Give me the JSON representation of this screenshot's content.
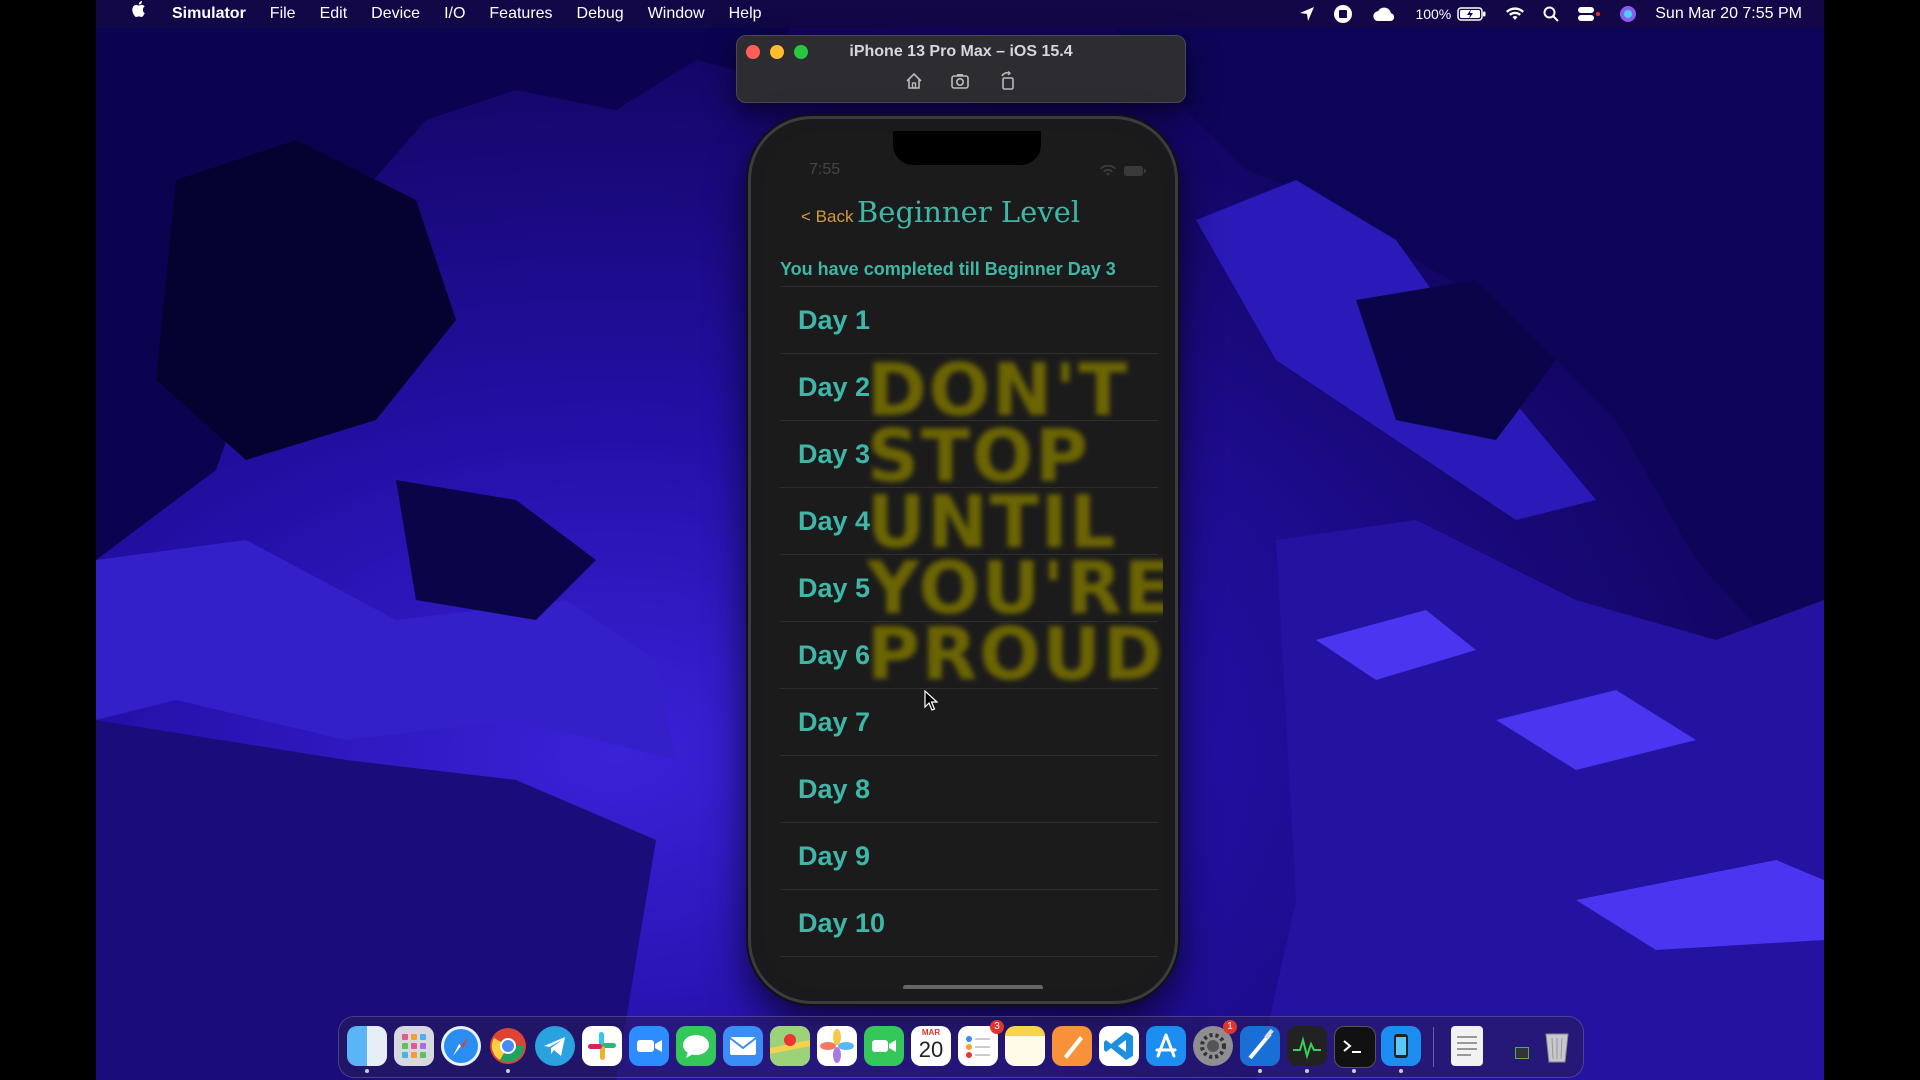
{
  "menubar": {
    "app": "Simulator",
    "items": [
      "File",
      "Edit",
      "Device",
      "I/O",
      "Features",
      "Debug",
      "Window",
      "Help"
    ],
    "battery": "100%",
    "datetime": "Sun Mar 20  7:55 PM"
  },
  "simulator": {
    "title": "iPhone 13 Pro Max – iOS 15.4"
  },
  "phone": {
    "clock": "7:55",
    "back_label": "< Back",
    "title": "Beginner Level",
    "status": "You have completed till Beginner Day 3",
    "days": [
      "Day 1",
      "Day 2",
      "Day 3",
      "Day 4",
      "Day 5",
      "Day 6",
      "Day 7",
      "Day 8",
      "Day 9",
      "Day 10"
    ],
    "background_words": [
      "DON'T",
      "STOP",
      "UNTIL",
      "YOU'RE",
      "PROUD"
    ]
  },
  "dock": {
    "calendar_month": "MAR",
    "calendar_day": "20",
    "reminders_badge": "3",
    "settings_badge": "1",
    "apps": [
      "finder-icon",
      "launchpad-icon",
      "safari-icon",
      "chrome-icon",
      "telegram-icon",
      "slack-icon",
      "zoom-icon",
      "messages-icon",
      "mail-icon",
      "maps-icon",
      "photos-icon",
      "facetime-icon",
      "calendar-icon",
      "reminders-icon",
      "notes-icon",
      "pages-icon",
      "vscode-icon",
      "appstore-icon",
      "settings-icon",
      "xcode-icon",
      "activity-monitor-icon",
      "terminal-icon",
      "simulator-icon",
      "document-icon",
      "trash-icon"
    ]
  },
  "colors": {
    "accent_teal": "#3fb7a8",
    "back_orange": "#d29a3e",
    "poster_yellow": "#7a7200"
  }
}
